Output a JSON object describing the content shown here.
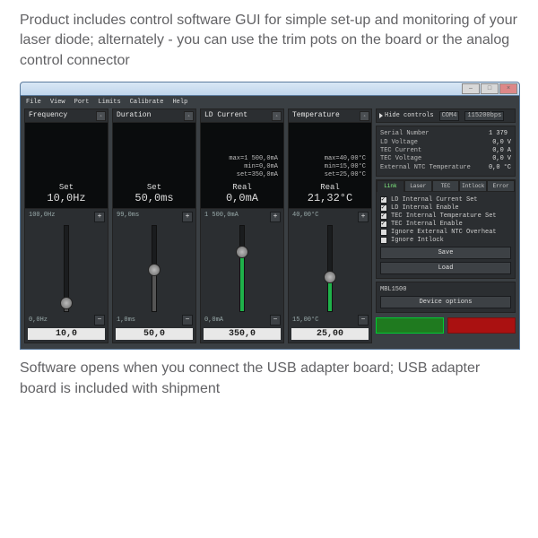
{
  "captions": {
    "top": "Product includes control software GUI for simple set-up and monitoring of your laser diode; alternately - you can use the trim pots on the board or the analog control connector",
    "bottom": "Software opens when you connect the USB adapter board; USB adapter board is included with shipment"
  },
  "menu": [
    "File",
    "View",
    "Port",
    "Limits",
    "Calibrate",
    "Help"
  ],
  "channels": [
    {
      "title": "Frequency",
      "info": [],
      "mid_label": "Set",
      "mid_value": "10,0Hz",
      "top_lbl": "100,0Hz",
      "bot_lbl": "0,0Hz",
      "entry": "10,0",
      "fill_pct": 10,
      "fill_class": "gray"
    },
    {
      "title": "Duration",
      "info": [],
      "mid_label": "Set",
      "mid_value": "50,0ms",
      "top_lbl": "99,0ms",
      "bot_lbl": "1,0ms",
      "entry": "50,0",
      "fill_pct": 49,
      "fill_class": "gray"
    },
    {
      "title": "LD Current",
      "info": [
        "max=1 500,0mA",
        "min=0,0mA",
        "set=350,0mA"
      ],
      "mid_label": "Real",
      "mid_value": "0,0mA",
      "top_lbl": "1 500,0mA",
      "bot_lbl": "0,0mA",
      "entry": "350,0",
      "fill_pct": 70,
      "fill_class": "green"
    },
    {
      "title": "Temperature",
      "info": [
        "max=40,00°C",
        "min=15,00°C",
        "set=25,00°C"
      ],
      "mid_label": "Real",
      "mid_value": "21,32°C",
      "top_lbl": "40,00°C",
      "bot_lbl": "15,00°C",
      "entry": "25,00",
      "fill_pct": 40,
      "fill_class": "green"
    }
  ],
  "side": {
    "hide_label": "Hide controls",
    "port": "COM4",
    "baud": "115200bps",
    "info": [
      {
        "k": "Serial Number",
        "v": "1 379",
        "u": ""
      },
      {
        "k": "LD Voltage",
        "v": "0,0",
        "u": "V"
      },
      {
        "k": "TEC Current",
        "v": "0,0",
        "u": "A"
      },
      {
        "k": "TEC Voltage",
        "v": "0,0",
        "u": "V"
      },
      {
        "k": "External NTC Temperature",
        "v": "0,0",
        "u": "°C"
      }
    ],
    "tabs": [
      "Link",
      "Laser",
      "TEC",
      "Intlock",
      "Error"
    ],
    "checks": [
      {
        "on": true,
        "label": "LD Internal Current Set"
      },
      {
        "on": true,
        "label": "LD Internal Enable"
      },
      {
        "on": true,
        "label": "TEC Internal Temperature Set"
      },
      {
        "on": true,
        "label": "TEC Internal Enable"
      },
      {
        "on": false,
        "label": "Ignore External NTC Overheat"
      },
      {
        "on": false,
        "label": "Ignore Intlock"
      }
    ],
    "save": "Save",
    "load": "Load",
    "model": "MBL1500",
    "opts": "Device options"
  }
}
